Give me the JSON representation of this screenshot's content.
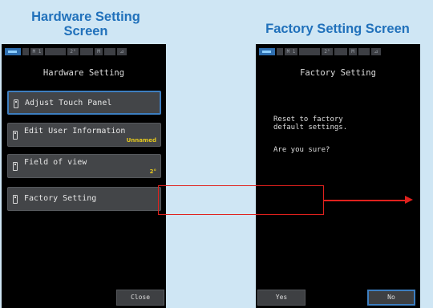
{
  "left": {
    "caption": "Hardware Setting\nScreen",
    "status": [
      "",
      "M 1",
      "",
      "2°",
      "",
      "M",
      "",
      "⊿"
    ],
    "title": "Hardware Setting",
    "menu": [
      {
        "label": "Adjust Touch Panel",
        "sub": ""
      },
      {
        "label": "Edit User Information",
        "sub": "Unnamed"
      },
      {
        "label": "Field of view",
        "sub": "2°"
      },
      {
        "label": "Factory Setting",
        "sub": ""
      }
    ],
    "close_label": "Close"
  },
  "right": {
    "caption": "Factory Setting Screen",
    "status": [
      "",
      "M 1",
      "",
      "2°",
      "",
      "M",
      "",
      "⊿"
    ],
    "title": "Factory Setting",
    "message": "Reset to factory\ndefault settings.",
    "question": "Are you sure?",
    "yes_label": "Yes",
    "no_label": "No"
  },
  "colors": {
    "caption": "#2171bb",
    "highlight": "#e0211d",
    "selected_border": "#3d7ec0",
    "sub_value": "#e3c71e",
    "background": "#cfe6f4"
  }
}
